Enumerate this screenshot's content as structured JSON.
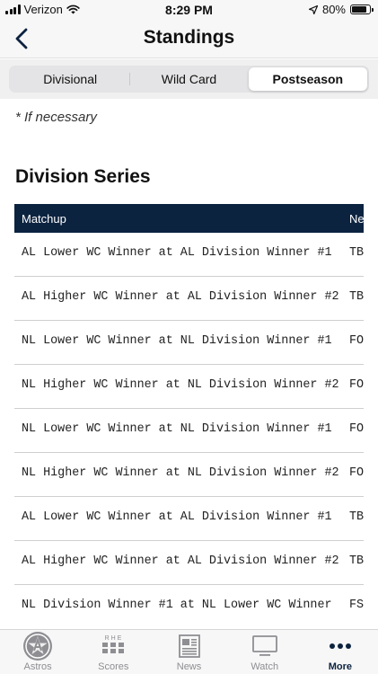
{
  "status_bar": {
    "carrier": "Verizon",
    "time": "8:29 PM",
    "battery": "80%"
  },
  "nav": {
    "title": "Standings"
  },
  "segments": [
    {
      "label": "Divisional",
      "active": false
    },
    {
      "label": "Wild Card",
      "active": false
    },
    {
      "label": "Postseason",
      "active": true
    }
  ],
  "note": "* If necessary",
  "section_title": "Division Series",
  "table": {
    "headers": [
      "Matchup",
      "Ne"
    ],
    "rows": [
      [
        "AL Lower WC Winner at AL Division Winner #1",
        "TB"
      ],
      [
        "AL Higher WC Winner at AL Division Winner #2",
        "TB"
      ],
      [
        "NL Lower WC Winner at NL Division Winner #1",
        "FO"
      ],
      [
        "NL Higher WC Winner at NL Division Winner #2",
        "FO"
      ],
      [
        "NL Lower WC Winner at NL Division Winner #1",
        "FO"
      ],
      [
        "NL Higher WC Winner at NL Division Winner #2",
        "FO"
      ],
      [
        "AL Lower WC Winner at AL Division Winner #1",
        "TB"
      ],
      [
        "AL Higher WC Winner at AL Division Winner #2",
        "TB"
      ],
      [
        "NL Division Winner #1 at NL Lower WC Winner",
        "FS"
      ]
    ]
  },
  "tabs": [
    {
      "label": "Astros",
      "icon": "astros-logo-icon",
      "active": false
    },
    {
      "label": "Scores",
      "icon": "scoreboard-icon",
      "active": false
    },
    {
      "label": "News",
      "icon": "newspaper-icon",
      "active": false
    },
    {
      "label": "Watch",
      "icon": "tv-icon",
      "active": false
    },
    {
      "label": "More",
      "icon": "more-dots-icon",
      "active": true
    }
  ],
  "scoreboard_icon_text": "R H E",
  "colors": {
    "navy": "#0c2340",
    "accent_blue": "#0c2340",
    "inactive_gray": "#8e8e93"
  }
}
